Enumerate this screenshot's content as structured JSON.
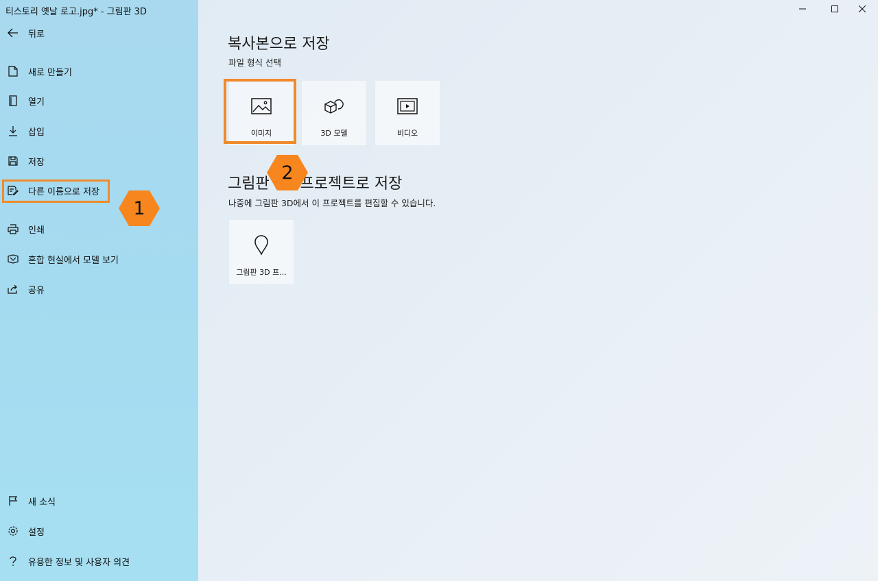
{
  "window": {
    "title": "티스토리 옛날 로고.jpg* - 그림판 3D"
  },
  "sidebar": {
    "back_label": "뒤로",
    "items": [
      {
        "label": "새로 만들기",
        "icon": "new-file-icon"
      },
      {
        "label": "열기",
        "icon": "open-file-icon"
      },
      {
        "label": "삽입",
        "icon": "insert-icon"
      },
      {
        "label": "저장",
        "icon": "save-icon"
      },
      {
        "label": "다른 이름으로 저장",
        "icon": "save-as-icon"
      },
      {
        "label": "인쇄",
        "icon": "print-icon"
      },
      {
        "label": "혼합 현실에서 모델 보기",
        "icon": "mixed-reality-icon"
      },
      {
        "label": "공유",
        "icon": "share-icon"
      }
    ],
    "bottom_items": [
      {
        "label": "새 소식",
        "icon": "flag-icon"
      },
      {
        "label": "설정",
        "icon": "gear-icon"
      },
      {
        "label": "유용한 정보 및 사용자 의견",
        "icon": "help-icon"
      }
    ]
  },
  "callouts": {
    "step1": "1",
    "step2": "2"
  },
  "main": {
    "copy_section": {
      "title": "복사본으로 저장",
      "subtitle": "파일 형식 선택",
      "tiles": [
        {
          "label": "이미지",
          "icon": "image-icon"
        },
        {
          "label": "3D 모델",
          "icon": "3d-model-icon"
        },
        {
          "label": "비디오",
          "icon": "video-icon"
        }
      ]
    },
    "project_section": {
      "title": "그림판 3D 프로젝트로 저장",
      "subtitle": "나중에 그림판 3D에서 이 프로젝트를 편집할 수 있습니다.",
      "tiles": [
        {
          "label": "그림판 3D 프...",
          "icon": "paint3d-project-icon"
        }
      ]
    }
  },
  "colors": {
    "highlight": "#f08a2b",
    "callout": "#f7861f",
    "sidebar": "#a6dbf0"
  }
}
